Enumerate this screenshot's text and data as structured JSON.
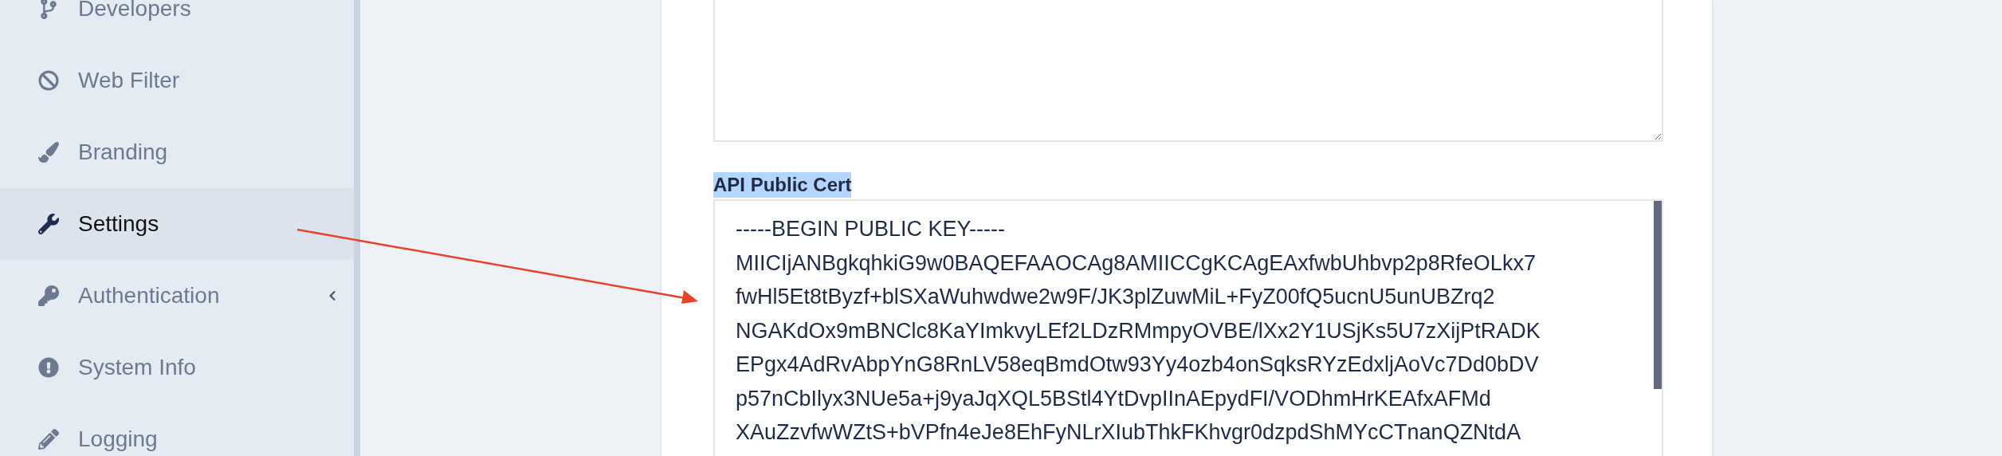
{
  "sidebar": {
    "items": [
      {
        "label": "Developers",
        "selected": false,
        "has_submenu": false
      },
      {
        "label": "Web Filter",
        "selected": false,
        "has_submenu": false
      },
      {
        "label": "Branding",
        "selected": false,
        "has_submenu": false
      },
      {
        "label": "Settings",
        "selected": true,
        "has_submenu": false
      },
      {
        "label": "Authentication",
        "selected": false,
        "has_submenu": true
      },
      {
        "label": "System Info",
        "selected": false,
        "has_submenu": false
      },
      {
        "label": "Logging",
        "selected": false,
        "has_submenu": false
      }
    ]
  },
  "api_public_cert": {
    "label": "API Public Cert",
    "label_highlighted": true,
    "lines": [
      "-----BEGIN PUBLIC KEY-----",
      "MIICIjANBgkqhkiG9w0BAQEFAAOCAg8AMIICCgKCAgEAxfwbUhbvp2p8RfeOLkx7",
      "fwHl5Et8tByzf+blSXaWuhwdwe2w9F/JK3plZuwMiL+FyZ00fQ5ucnU5unUBZrq2",
      "NGAKdOx9mBNClc8KaYImkvyLEf2LDzRMmpyOVBE/lXx2Y1USjKs5U7zXijPtRADK",
      "EPgx4AdRvAbpYnG8RnLV58eqBmdOtw93Yy4ozb4onSqksRYzEdxljAoVc7Dd0bDV",
      "p57nCbIlyx3NUe5a+j9yaJqXQL5BStl4YtDvpIInAEpydFI/VODhmHrKEAfxAFMd",
      "XAuZzvfwWZtS+bVPfn4eJe8EhFyNLrXIubThkFKhvgr0dzpdShMYcCTnanQZNtdA"
    ]
  },
  "annotation": {
    "kind": "arrow"
  }
}
